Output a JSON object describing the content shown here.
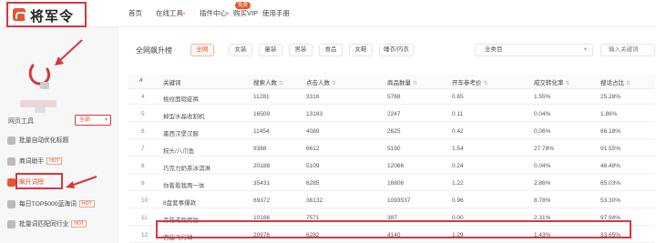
{
  "app": {
    "logo_text": "将军令"
  },
  "nav": {
    "items": [
      {
        "label": "首页",
        "dot": ""
      },
      {
        "label": "在线工具",
        "dot": "•"
      },
      {
        "label": "插件中心",
        "dot": "•"
      },
      {
        "label": "购买VIP",
        "dot": ""
      },
      {
        "label": "使用手册",
        "dot": ""
      }
    ],
    "badge": "免费"
  },
  "sidebar": {
    "tools_label": "网页工具",
    "tools_select": "全部",
    "items": [
      {
        "label": "批量自动优化标题",
        "hot": ""
      },
      {
        "label": "商词助手",
        "hot": "HOT"
      },
      {
        "label": "飙升词榜",
        "hot": ""
      },
      {
        "label": "每日TOP5000蓝海词",
        "hot": "HOT"
      },
      {
        "label": "批量词匹配同行业",
        "hot": "HOT"
      }
    ]
  },
  "main": {
    "title": "全网飙升榜",
    "tags": [
      "全网",
      "女装",
      "童装",
      "男装",
      "食品",
      "女鞋",
      "睡衣/内衣"
    ],
    "active_tag": 0,
    "category_select": "全类目",
    "keyword_placeholder": "输入关键词"
  },
  "table": {
    "headers": [
      "#",
      "关键词",
      "搜索人数",
      "点击人数",
      "商品数量",
      "开车参考价",
      "成交转化率",
      "搜话占比"
    ],
    "rows": [
      [
        "4",
        "桃纹面瑕疵裤",
        "11281",
        "3316",
        "5768",
        "0.65",
        "1.55%",
        "25.28%"
      ],
      [
        "5",
        "掉型水晶收割机",
        "16509",
        "13183",
        "2247",
        "0.11",
        "0.04%",
        "1.86%"
      ],
      [
        "6",
        "墨西汉堡汉服",
        "11454",
        "4089",
        "2625",
        "0.42",
        "0.06%",
        "66.18%"
      ],
      [
        "7",
        "狗头/八爪鱼",
        "9388",
        "6612",
        "5190",
        "1.54",
        "27.78%",
        "91.55%"
      ],
      [
        "8",
        "巧克力奶茶冰淇淋",
        "20188",
        "5109",
        "12066",
        "0.24",
        "0.04%",
        "46.48%"
      ],
      [
        "9",
        "你看看我两一体",
        "35431",
        "6285",
        "16806",
        "1.22",
        "2.86%",
        "65.03%"
      ],
      [
        "10",
        "8盘套事爆款",
        "69372",
        "36132",
        "1093537",
        "0.96",
        "8.78%",
        "53.30%"
      ],
      [
        "11",
        "森陆诺隐腐蚀",
        "10166",
        "7571",
        "387",
        "0.00",
        "2.31%",
        "97.94%"
      ],
      [
        "12",
        "宫廷飞行球",
        "20976",
        "6282",
        "4140",
        "1.29",
        "1.43%",
        "33.65%"
      ]
    ]
  },
  "colors": {
    "accent": "#e8542f",
    "highlight": "#d9363e"
  }
}
